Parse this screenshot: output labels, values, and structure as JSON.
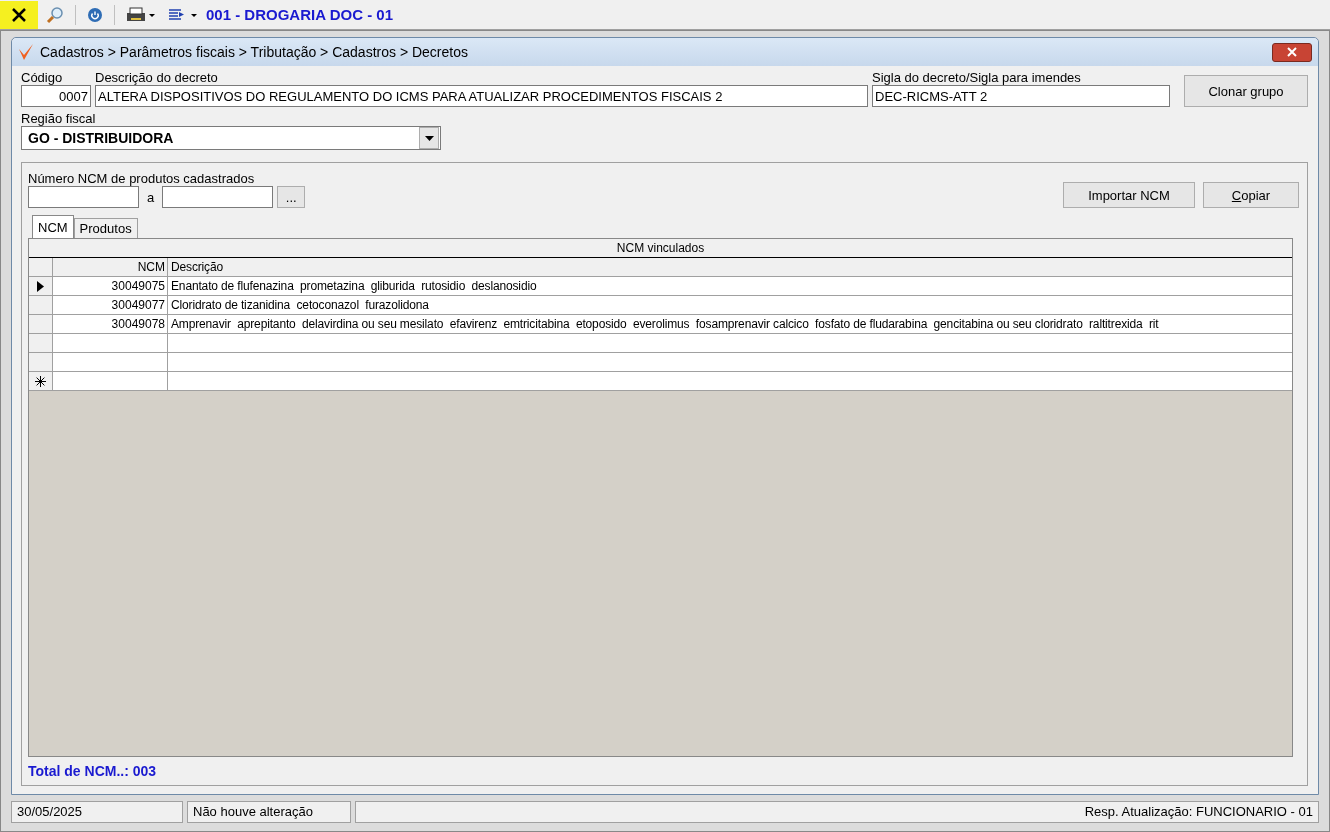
{
  "toolbar": {
    "company": "001 - DROGARIA DOC - 01"
  },
  "window": {
    "title": "Cadastros > Parâmetros fiscais > Tributação > Cadastros > Decretos"
  },
  "form": {
    "codigo_label": "Código",
    "codigo": "0007",
    "descricao_label": "Descrição do decreto",
    "descricao": "ALTERA DISPOSITIVOS DO REGULAMENTO DO ICMS PARA ATUALIZAR PROCEDIMENTOS FISCAIS 2",
    "sigla_label": "Sigla do decreto/Sigla para imendes",
    "sigla": "DEC-RICMS-ATT 2",
    "clone_button": "Clonar grupo",
    "regiao_label": "Região fiscal",
    "regiao": "GO - DISTRIBUIDORA"
  },
  "filter": {
    "label": "Número  NCM de produtos cadastrados",
    "separator": "a",
    "browse_button": "...",
    "import_button": "Importar NCM",
    "copy_button": "Copiar"
  },
  "tabs": [
    {
      "label": "NCM",
      "selected": true
    },
    {
      "label": "Produtos",
      "selected": false
    }
  ],
  "table": {
    "caption": "NCM vinculados",
    "columns": [
      "NCM",
      "Descrição"
    ],
    "rows": [
      {
        "kind": "data",
        "selected": true,
        "ncm": "30049075",
        "descricao": "Enantato de flufenazina  prometazina  gliburida  rutosidio  deslanosidio"
      },
      {
        "kind": "data",
        "selected": false,
        "ncm": "30049077",
        "descricao": "Cloridrato de tizanidina  cetoconazol  furazolidona"
      },
      {
        "kind": "data",
        "selected": false,
        "ncm": "30049078",
        "descricao": "Amprenavir  aprepitanto  delavirdina ou seu mesilato  efavirenz  emtricitabina  etoposido  everolimus  fosamprenavir calcico  fosfato de fludarabina  gencitabina ou seu cloridrato  raltitrexida  rit"
      },
      {
        "kind": "empty",
        "selected": false
      },
      {
        "kind": "empty",
        "selected": false
      },
      {
        "kind": "new",
        "selected": false
      }
    ]
  },
  "total": "Total de NCM..: 003",
  "status_bar": {
    "date": "30/05/2025",
    "message": "Não houve alteração",
    "user": "Resp. Atualização: FUNCIONARIO - 01"
  }
}
